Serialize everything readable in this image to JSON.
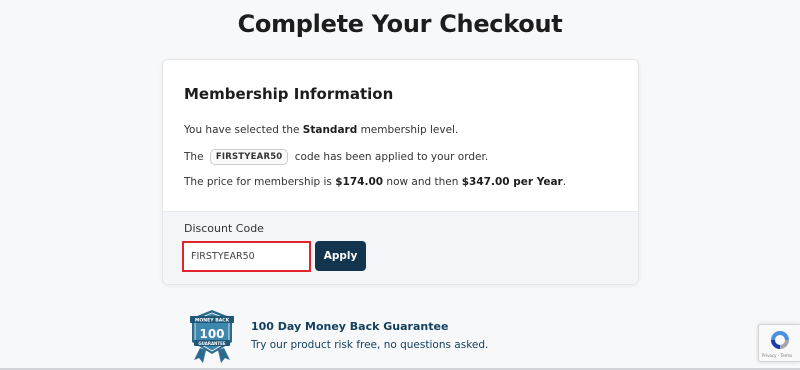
{
  "page": {
    "title": "Complete Your Checkout"
  },
  "membership": {
    "heading": "Membership Information",
    "line1_prefix": "You have selected the ",
    "line1_level": "Standard",
    "line1_suffix": " membership level.",
    "line2_prefix": "The ",
    "line2_code": "FIRSTYEAR50",
    "line2_suffix": " code has been applied to your order.",
    "line3_prefix": "The price for membership is ",
    "line3_initial": "$174.00",
    "line3_mid": " now and then ",
    "line3_recurring": "$347.00 per Year",
    "line3_end": "."
  },
  "discount": {
    "label": "Discount Code",
    "value": "FIRSTYEAR50",
    "apply_label": "Apply",
    "highlight_color": "#e0242e"
  },
  "guarantee": {
    "title": "100 Day Money Back Guarantee",
    "subtitle": "Try our product risk free, no questions asked.",
    "badge_top": "MONEY BACK",
    "badge_number": "100",
    "badge_bottom": "GUARANTEE"
  },
  "recaptcha": {
    "links": "Privacy - Terms"
  },
  "colors": {
    "accent": "#12344d",
    "guarantee_text": "#14405e"
  }
}
